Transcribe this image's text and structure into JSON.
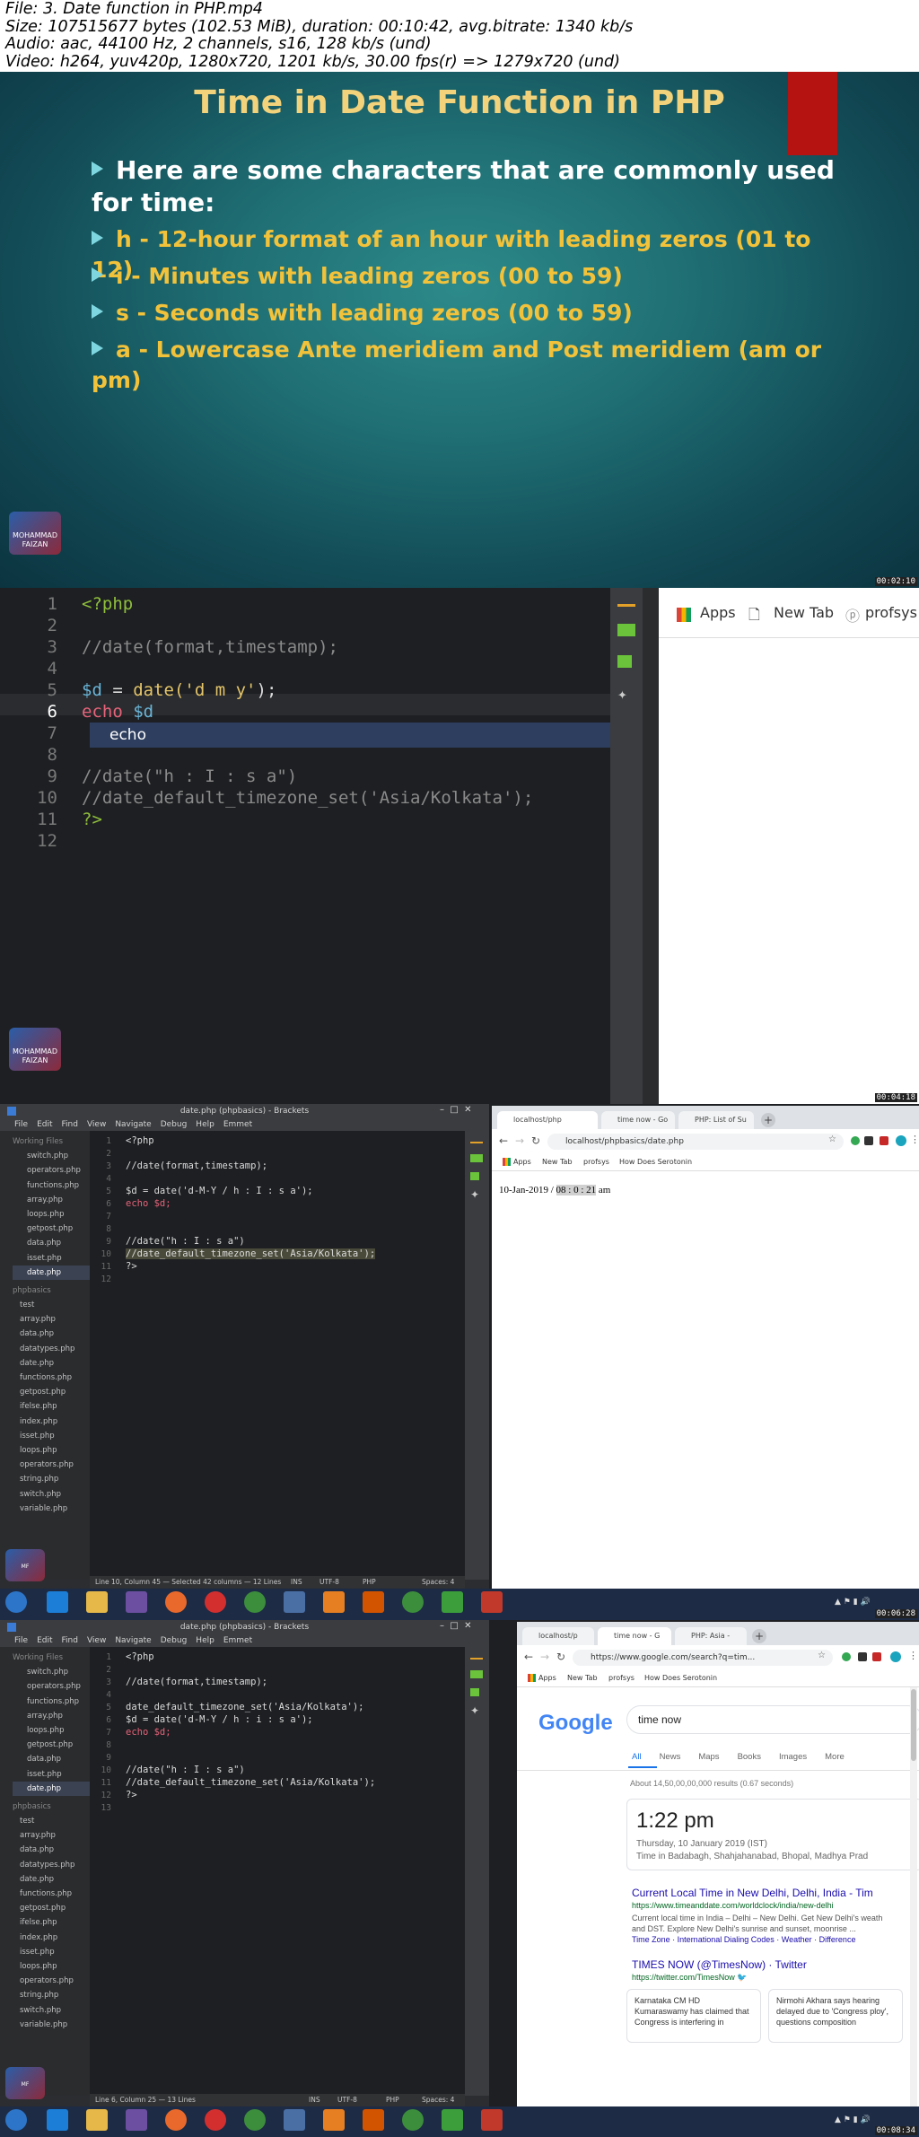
{
  "header": {
    "line1": "File: 3. Date function in PHP.mp4",
    "line2": "Size: 107515677 bytes (102.53 MiB), duration: 00:10:42, avg.bitrate: 1340 kb/s",
    "line3": "Audio: aac, 44100 Hz, 2 channels, s16, 128 kb/s (und)",
    "line4": "Video: h264, yuv420p, 1280x720, 1201 kb/s, 30.00 fps(r) => 1279x720 (und)"
  },
  "slide": {
    "title": "Time in Date Function in PHP",
    "intro": "Here are some characters that are commonly used for time:",
    "items": [
      "h - 12-hour format of an hour with leading zeros (01 to 12)",
      "i - Minutes with leading zeros (00 to 59)",
      "s - Seconds with leading zeros (00 to 59)",
      "a - Lowercase Ante meridiem and Post meridiem (am or pm)"
    ],
    "logo_text": "MOHAMMAD FAIZAN",
    "timestamp": "00:02:10"
  },
  "frame2": {
    "lines": [
      "1",
      "2",
      "3",
      "4",
      "5",
      "6",
      "7",
      "8",
      "9",
      "10",
      "11",
      "12"
    ],
    "code": {
      "l1": "<?php",
      "l3": "//date(format,timestamp);",
      "l5_var": "$d",
      "l5_eq": " = ",
      "l5_fn": "date(",
      "l5_str": "'d m y'",
      "l5_end": ");",
      "l6_kw": "echo",
      "l6_var": " $d",
      "l9": "//date(\"h : I : s a\")",
      "l10": "//date_default_timezone_set('Asia/Kolkata');",
      "l11": "?>"
    },
    "hint": "echo",
    "browser": {
      "apps": "Apps",
      "newtab": "New Tab",
      "profsys": "profsys"
    },
    "logo_text": "MOHAMMAD FAIZAN",
    "timestamp": "00:04:18"
  },
  "frame3": {
    "title": "date.php (phpbasics) - Brackets",
    "menu": [
      "File",
      "Edit",
      "Find",
      "View",
      "Navigate",
      "Debug",
      "Help",
      "Emmet"
    ],
    "working_files_label": "Working Files",
    "working_files": [
      "switch.php",
      "operators.php",
      "functions.php",
      "array.php",
      "loops.php",
      "getpost.php",
      "data.php",
      "isset.php",
      "date.php"
    ],
    "project_label": "phpbasics",
    "project_files": [
      "test",
      "array.php",
      "data.php",
      "datatypes.php",
      "date.php",
      "functions.php",
      "getpost.php",
      "ifelse.php",
      "index.php",
      "isset.php",
      "loops.php",
      "operators.php",
      "string.php",
      "switch.php",
      "variable.php"
    ],
    "lines": [
      "1",
      "2",
      "3",
      "4",
      "5",
      "6",
      "7",
      "8",
      "9",
      "10",
      "11",
      "12"
    ],
    "code": {
      "l1": "<?php",
      "l3": "//date(format,timestamp);",
      "l5": "$d = date('d-M-Y / h : I : s a');",
      "l6": "echo $d;",
      "l9": "//date(\"h : I : s a\")",
      "l10": "//date_default_timezone_set('Asia/Kolkata');",
      "l11": "?>"
    },
    "status": "Line 10, Column 45 — Selected 42 columns — 12 Lines",
    "status_right": [
      "INS",
      "UTF-8",
      "PHP",
      "Spaces: 4"
    ],
    "tabs": [
      "localhost/php",
      "time now - Go",
      "PHP: List of Su"
    ],
    "url": "localhost/phpbasics/date.php",
    "bookmarks": [
      "Apps",
      "New Tab",
      "profsys",
      "How Does Serotonin"
    ],
    "output_date": "10-Jan-2019 / ",
    "output_time": "08 : 0 : 21",
    "output_ampm": " am",
    "timestamp": "00:06:28"
  },
  "frame4": {
    "title": "date.php (phpbasics) - Brackets",
    "menu": [
      "File",
      "Edit",
      "Find",
      "View",
      "Navigate",
      "Debug",
      "Help",
      "Emmet"
    ],
    "working_files_label": "Working Files",
    "working_files": [
      "switch.php",
      "operators.php",
      "functions.php",
      "array.php",
      "loops.php",
      "getpost.php",
      "data.php",
      "isset.php",
      "date.php"
    ],
    "project_label": "phpbasics",
    "project_files": [
      "test",
      "array.php",
      "data.php",
      "datatypes.php",
      "date.php",
      "functions.php",
      "getpost.php",
      "ifelse.php",
      "index.php",
      "isset.php",
      "loops.php",
      "operators.php",
      "string.php",
      "switch.php",
      "variable.php"
    ],
    "lines": [
      "1",
      "2",
      "3",
      "4",
      "5",
      "6",
      "7",
      "8",
      "9",
      "10",
      "11",
      "12",
      "13"
    ],
    "code": {
      "l1": "<?php",
      "l3": "//date(format,timestamp);",
      "l5": "date_default_timezone_set('Asia/Kolkata');",
      "l6": "$d = date('d-M-Y / h : i : s a');",
      "l7": "echo $d;",
      "l10": "//date(\"h : I : s a\")",
      "l11": "//date_default_timezone_set('Asia/Kolkata');",
      "l12": "?>"
    },
    "status": "Line 6, Column 25 — 13 Lines",
    "status_right": [
      "INS",
      "UTF-8",
      "PHP",
      "Spaces: 4"
    ],
    "tabs": [
      "localhost/p",
      "time now - G",
      "PHP: Asia - "
    ],
    "url": "https://www.google.com/search?q=tim...",
    "bookmarks": [
      "Apps",
      "New Tab",
      "profsys",
      "How Does Serotonin"
    ],
    "google": {
      "logo": "Google",
      "query": "time now",
      "nav": [
        "All",
        "News",
        "Maps",
        "Books",
        "Images",
        "More"
      ],
      "results_count": "About 14,50,00,00,000 results (0.67 seconds)",
      "time": "1:22 pm",
      "date": "Thursday, 10 January 2019 (IST)",
      "place": "Time in Badabagh, Shahjahanabad, Bhopal, Madhya Prad",
      "r1_title": "Current Local Time in New Delhi, Delhi, India - Tim",
      "r1_url": "https://www.timeanddate.com/worldclock/india/new-delhi",
      "r1_snip1": "Current local time in India – Delhi – New Delhi. Get New Delhi's weath",
      "r1_snip2": "and DST. Explore New Delhi's sunrise and sunset, moonrise ...",
      "r1_links": "Time Zone · International Dialing Codes · Weather · Difference",
      "r2_title": "TIMES NOW (@TimesNow) · Twitter",
      "r2_url": "https://twitter.com/TimesNow",
      "tw1": "Karnataka CM HD Kumaraswamy has claimed that Congress is interfering in",
      "tw2": "Nirmohi Akhara says hearing delayed due to 'Congress ploy', questions composition"
    },
    "timestamp": "00:08:34"
  },
  "colors": {
    "slide_title": "#f2d27a",
    "bullet_text": "#ffffff",
    "bullet_item": "#f2c23a",
    "code_keyword": "#8fbe3c",
    "code_var": "#6ab5d8",
    "code_string": "#e5c56a"
  }
}
